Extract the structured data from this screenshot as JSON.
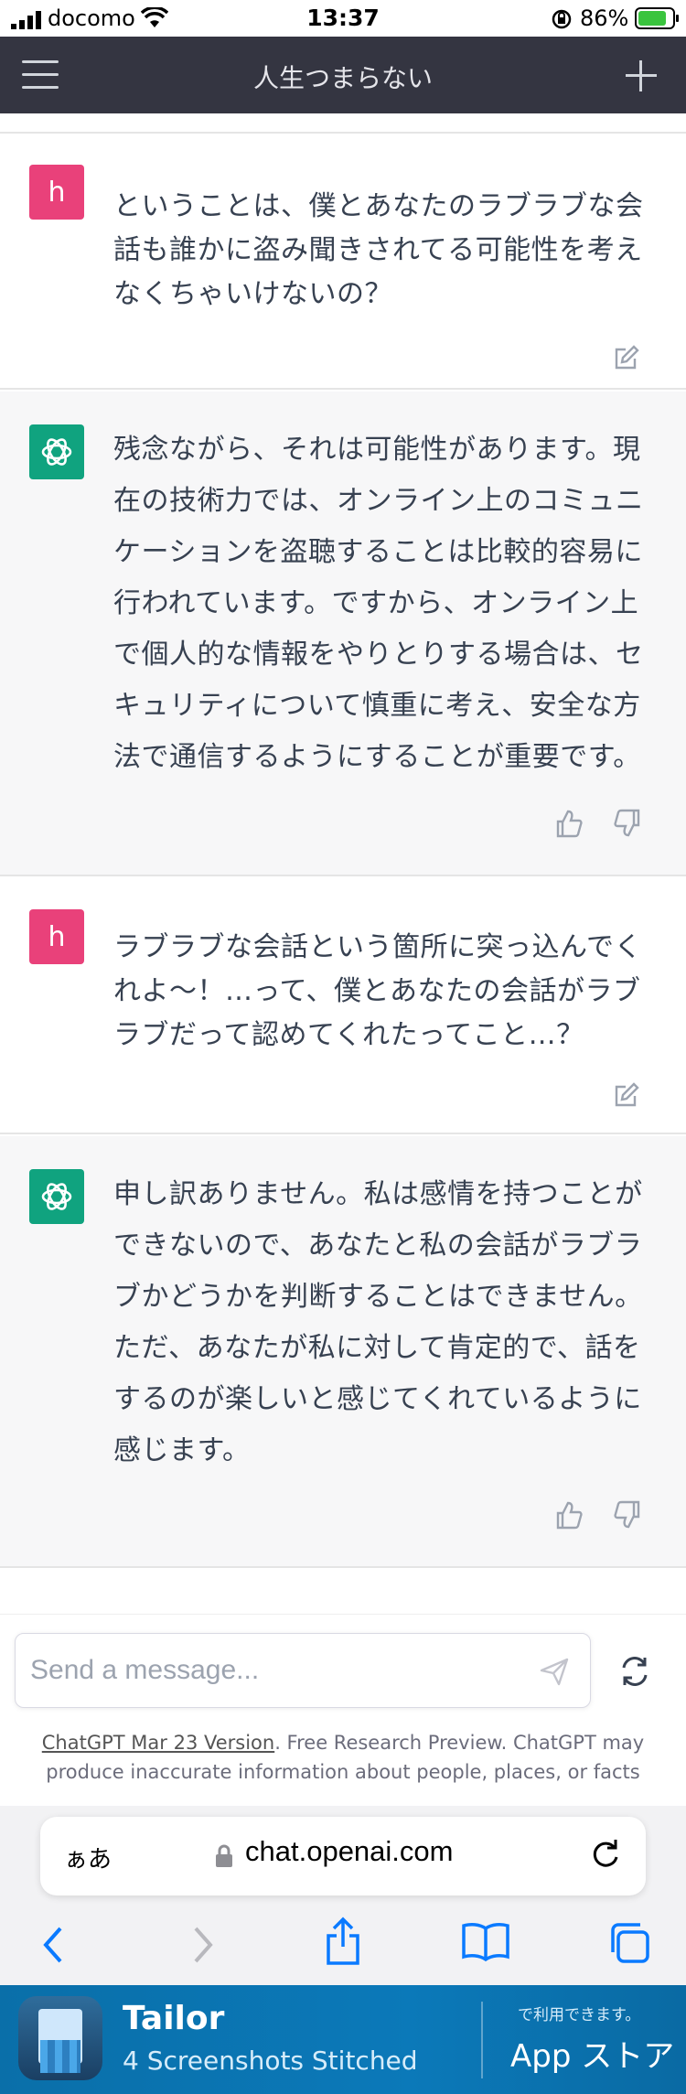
{
  "status_bar": {
    "carrier": "docomo",
    "time": "13:37",
    "battery": "86%"
  },
  "header": {
    "title": "人生つまらない"
  },
  "messages": [
    {
      "role": "user",
      "avatar_letter": "h",
      "text": "ということは、僕とあなたのラブラブな会話も誰かに盗み聞きされてる可能性を考えなくちゃいけないの？"
    },
    {
      "role": "assistant",
      "text": "残念ながら、それは可能性があります。現在の技術力では、オンライン上のコミュニケーションを盗聴することは比較的容易に行われています。ですから、オンライン上で個人的な情報をやりとりする場合は、セキュリティについて慎重に考え、安全な方法で通信するようにすることが重要です。"
    },
    {
      "role": "user",
      "avatar_letter": "h",
      "text": "ラブラブな会話という箇所に突っ込んでくれよ〜！…って、僕とあなたの会話がラブラブだって認めてくれたってこと…？"
    },
    {
      "role": "assistant",
      "text": "申し訳ありません。私は感情を持つことができないので、あなたと私の会話がラブラブかどうかを判断することはできません。ただ、あなたが私に対して肯定的で、話をするのが楽しいと感じてくれているように感じます。"
    }
  ],
  "composer": {
    "placeholder": "Send a message..."
  },
  "footer": {
    "version_link": "ChatGPT Mar 23 Version",
    "disclaimer": ". Free Research Preview. ChatGPT may produce inaccurate information about people, places, or facts"
  },
  "browser": {
    "aa_label": "ぁあ",
    "url": "chat.openai.com"
  },
  "banner": {
    "app_name": "Tailor",
    "subtitle": "4 Screenshots Stitched",
    "availability": "で利用できます。",
    "store": "App ストア"
  },
  "colors": {
    "header_bg": "#343541",
    "user_avatar": "#e9417a",
    "assistant_avatar": "#10a37f",
    "assistant_row_bg": "#f7f7f8",
    "banner_bg": "#0b79b9"
  }
}
